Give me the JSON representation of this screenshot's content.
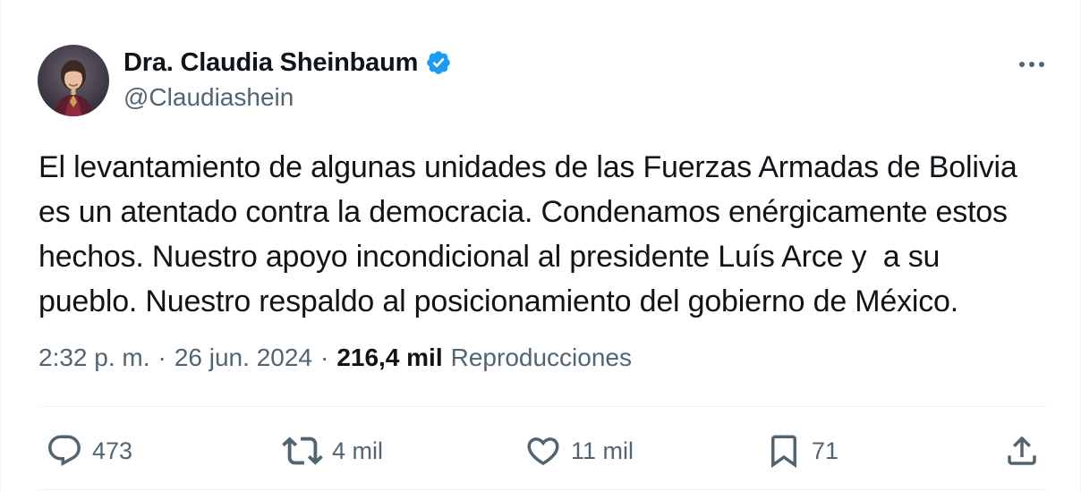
{
  "author": {
    "display_name": "Dra. Claudia Sheinbaum",
    "handle": "@Claudiashein",
    "verified": true
  },
  "tweet": {
    "text": "El levantamiento de algunas unidades de las Fuerzas Armadas de Bolivia\nes un atentado contra la democracia. Condenamos enérgicamente estos\nhechos. Nuestro apoyo incondicional al presidente Luís Arce y  a su\npueblo. Nuestro respaldo al posicionamiento del gobierno de México.",
    "time": "2:32 p. m.",
    "separator": "·",
    "date": "26 jun. 2024",
    "views_count": "216,4 mil",
    "views_label": "Reproducciones"
  },
  "actions": {
    "replies": "473",
    "reposts": "4 mil",
    "likes": "11 mil",
    "bookmarks": "71"
  },
  "icons": {
    "more": "more-dots-icon",
    "reply": "reply-bubble-icon",
    "repost": "repost-arrows-icon",
    "like": "heart-icon",
    "bookmark": "bookmark-icon",
    "share": "share-upload-icon",
    "verified": "verified-badge-icon"
  },
  "colors": {
    "text_primary": "#0f1419",
    "text_secondary": "#536471",
    "verified_blue": "#1d9bf0",
    "divider": "#eff3f4"
  }
}
